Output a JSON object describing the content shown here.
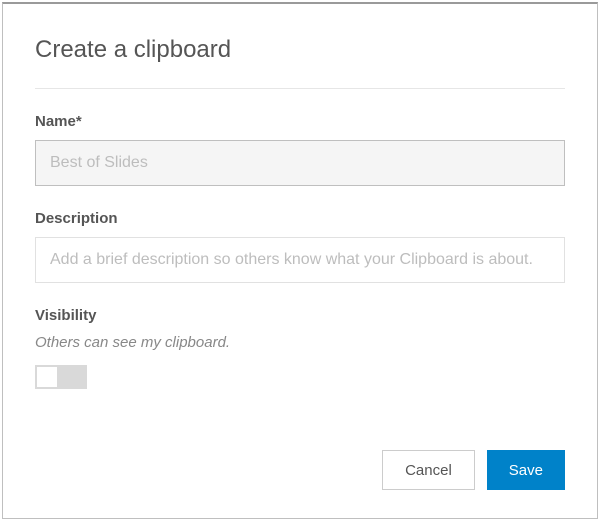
{
  "modal": {
    "title": "Create a clipboard",
    "name": {
      "label": "Name*",
      "placeholder": "Best of Slides",
      "value": ""
    },
    "description": {
      "label": "Description",
      "placeholder": "Add a brief description so others know what your Clipboard is about.",
      "value": ""
    },
    "visibility": {
      "label": "Visibility",
      "note": "Others can see my clipboard.",
      "enabled": false
    },
    "buttons": {
      "cancel": "Cancel",
      "save": "Save"
    }
  },
  "colors": {
    "accent": "#0082c9",
    "text": "#555555",
    "muted": "#888888",
    "border": "#bfbfbf"
  }
}
